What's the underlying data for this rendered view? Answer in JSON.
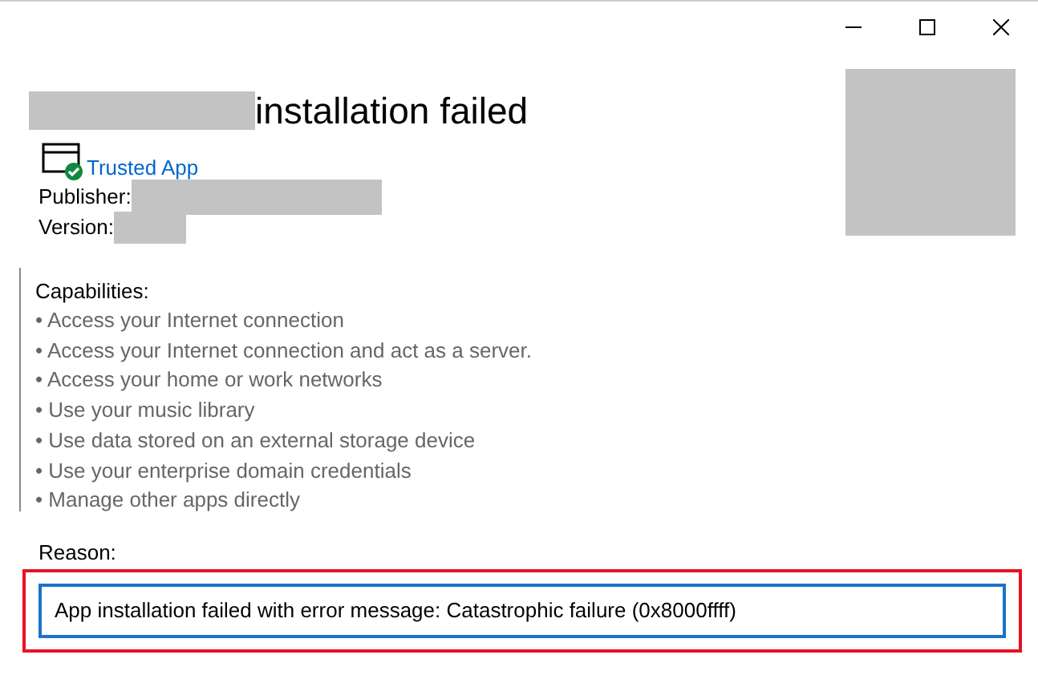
{
  "title_suffix": "installation failed",
  "trust_label": "Trusted App",
  "publisher_label": "Publisher:",
  "version_label": "Version:",
  "capabilities": {
    "heading": "Capabilities:",
    "items": [
      "• Access your Internet connection",
      "• Access your Internet connection and act as a server.",
      "• Access your home or work networks",
      "• Use your music library",
      "• Use data stored on an external storage device",
      "• Use your enterprise domain credentials",
      "• Manage other apps directly"
    ]
  },
  "reason": {
    "label": "Reason:",
    "message": "App installation failed with error message: Catastrophic failure (0x8000ffff)",
    "highlighted": true
  }
}
